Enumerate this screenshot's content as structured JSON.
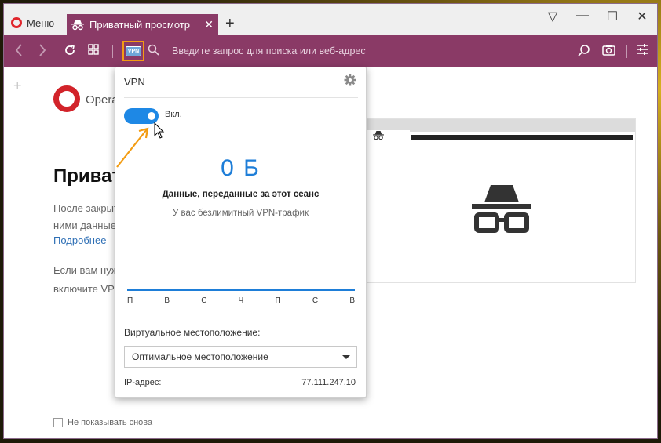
{
  "tabbar": {
    "menu_label": "Меню",
    "tab_title": "Приватный просмотр",
    "new_tab": "+",
    "close_tab": "✕"
  },
  "window_controls": {
    "menu": "▽",
    "minimize": "—",
    "maximize": "☐",
    "close": "✕"
  },
  "navbar": {
    "vpn_badge": "VPN",
    "address_placeholder": "Введите запрос для поиска или веб-адрес"
  },
  "page": {
    "brand": "Opera",
    "title": "Приватный просмотр",
    "paragraph1_line1": "После закрытия всех приватных окон Opera удалит",
    "paragraph1_line2": "ними данные: историю, файлы cookie и кэш.",
    "more_link": "Подробнее",
    "paragraph2_line1": "Если вам нужна ещё большая приватность,",
    "paragraph2_line2": "включите VPN в настройках.",
    "dont_show_again": "Не показывать снова"
  },
  "vpn": {
    "title": "VPN",
    "toggle_label": "Вкл.",
    "toggle_on": true,
    "data_amount": "0 Б",
    "data_caption": "Данные, переданные за этот сеанс",
    "data_sub": "У вас безлимитный VPN-трафик",
    "days": [
      "П",
      "В",
      "С",
      "Ч",
      "П",
      "С",
      "В"
    ],
    "location_label": "Виртуальное местоположение:",
    "location_value": "Оптимальное местоположение",
    "ip_label": "IP-адрес:",
    "ip_value": "77.111.247.10"
  },
  "colors": {
    "navbar": "#8a3a66",
    "accent_blue": "#1e7ed8",
    "highlight_orange": "#f39c12",
    "opera_red": "#d2232a"
  },
  "icons": {
    "back": "chevron-left-icon",
    "forward": "chevron-right-icon",
    "reload": "reload-icon",
    "speed_dial": "grid-icon",
    "search": "search-icon",
    "snapshot": "camera-icon",
    "easy_setup": "sliders-icon",
    "settings": "gear-icon",
    "incognito": "incognito-icon"
  }
}
